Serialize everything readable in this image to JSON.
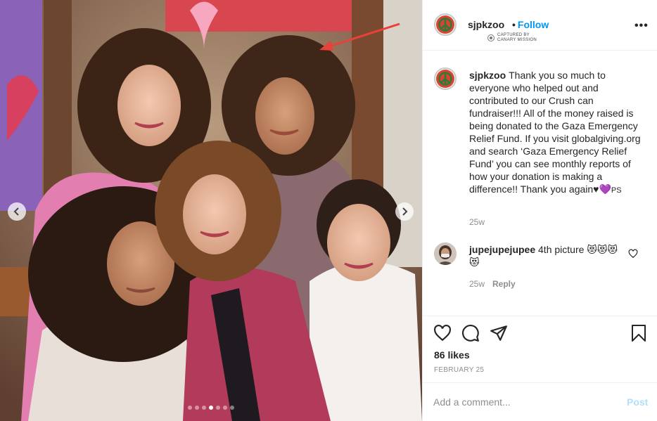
{
  "post": {
    "username": "sjpkzoo",
    "follow_separator": "•",
    "follow_label": "Follow",
    "captured_by": "CAPTURED BY",
    "captured_source": "CANARY MISSION",
    "more_label": "•••"
  },
  "caption": {
    "username": "sjpkzoo",
    "text": "Thank you so much to everyone who helped out and contributed to our Crush can fundraiser!!! All of the money raised is being donated to the Gaza Emergency Relief Fund. If you visit globalgiving.org and search ‘Gaza Emergency Relief Fund’ you can see monthly reports of how your donation is making a difference!! Thank you again",
    "hearts": "♥",
    "heart_purple": "💜",
    "signoff": "PS",
    "time": "25w"
  },
  "comment": {
    "username": "jupejupejupee",
    "text": "4th picture 😻😻😻😻",
    "time": "25w",
    "reply_label": "Reply"
  },
  "actions": {
    "likes": "86 likes",
    "date": "FEBRUARY 25"
  },
  "add_comment": {
    "placeholder": "Add a comment...",
    "post_label": "Post"
  },
  "carousel": {
    "count": 7,
    "active_index": 3
  },
  "icons": {
    "prev": "chevron-left-icon",
    "next": "chevron-right-icon",
    "like": "heart-outline-icon",
    "comment": "speech-bubble-icon",
    "share": "paper-plane-icon",
    "save": "bookmark-icon"
  },
  "colors": {
    "accent": "#0095f6",
    "post_disabled": "#b2dffc",
    "muted": "#8e8e8e",
    "annotation_arrow": "#e8413a"
  }
}
